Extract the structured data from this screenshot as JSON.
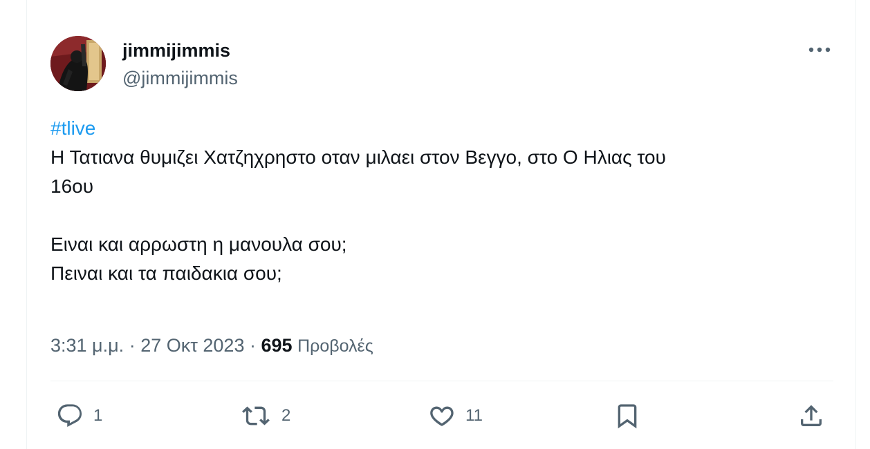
{
  "tweet": {
    "author": {
      "display_name": "jimmijimmis",
      "handle": "@jimmijimmis"
    },
    "hashtag": "#tlive",
    "lines": [
      "Η Τατιανα θυμιζει Χατζηχρηστο οταν μιλαει στον Βεγγο, στο Ο Ηλιας του",
      "16ου",
      "",
      "Ειναι και αρρωστη η μανουλα σου;",
      "Πειναι και τα παιδακια σου;"
    ],
    "time": "3:31 μ.μ.",
    "date": "27 Οκτ 2023",
    "views_count": "695",
    "views_label": "Προβολές"
  },
  "actions": {
    "reply_count": "1",
    "retweet_count": "2",
    "like_count": "11"
  },
  "icons": {
    "more": "more-horizontal-icon",
    "reply": "reply-icon",
    "retweet": "retweet-icon",
    "like": "heart-icon",
    "bookmark": "bookmark-icon",
    "share": "share-icon"
  },
  "colors": {
    "text": "#0f1419",
    "secondary": "#536471",
    "link": "#1d9bf0",
    "divider": "#eff3f4"
  }
}
